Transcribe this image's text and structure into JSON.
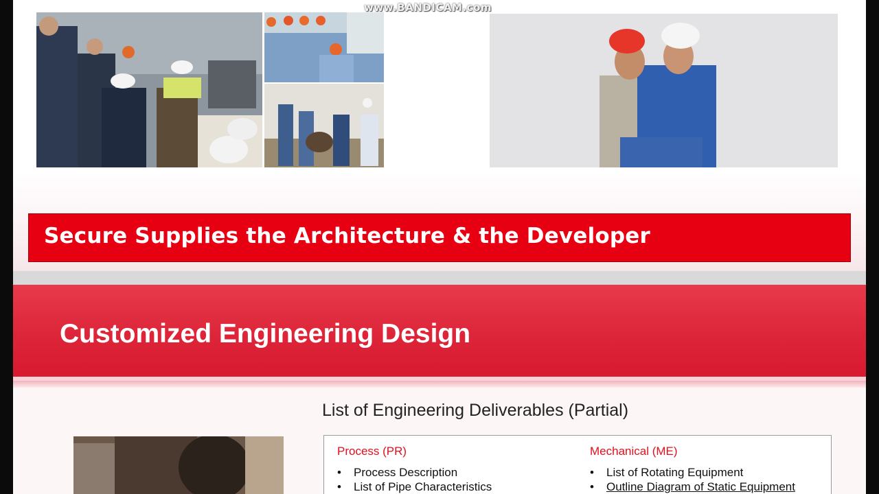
{
  "watermark": "www.BANDICAM.com",
  "banner": {
    "text": "Secure Supplies the Architecture & the Developer"
  },
  "section": {
    "title": "Customized Engineering Design"
  },
  "deliverables": {
    "title": "List of Engineering Deliverables (Partial)",
    "columns": [
      {
        "title": "Process (PR)",
        "items": [
          "Process Description",
          "List of Pipe Characteristics"
        ]
      },
      {
        "title": "Mechanical (ME)",
        "items": [
          "List of Rotating Equipment",
          "Outline Diagram of Static Equipment"
        ]
      }
    ]
  },
  "colors": {
    "banner_red": "#e60012",
    "band_red": "#dd2539",
    "column_title_red": "#e0101e"
  }
}
